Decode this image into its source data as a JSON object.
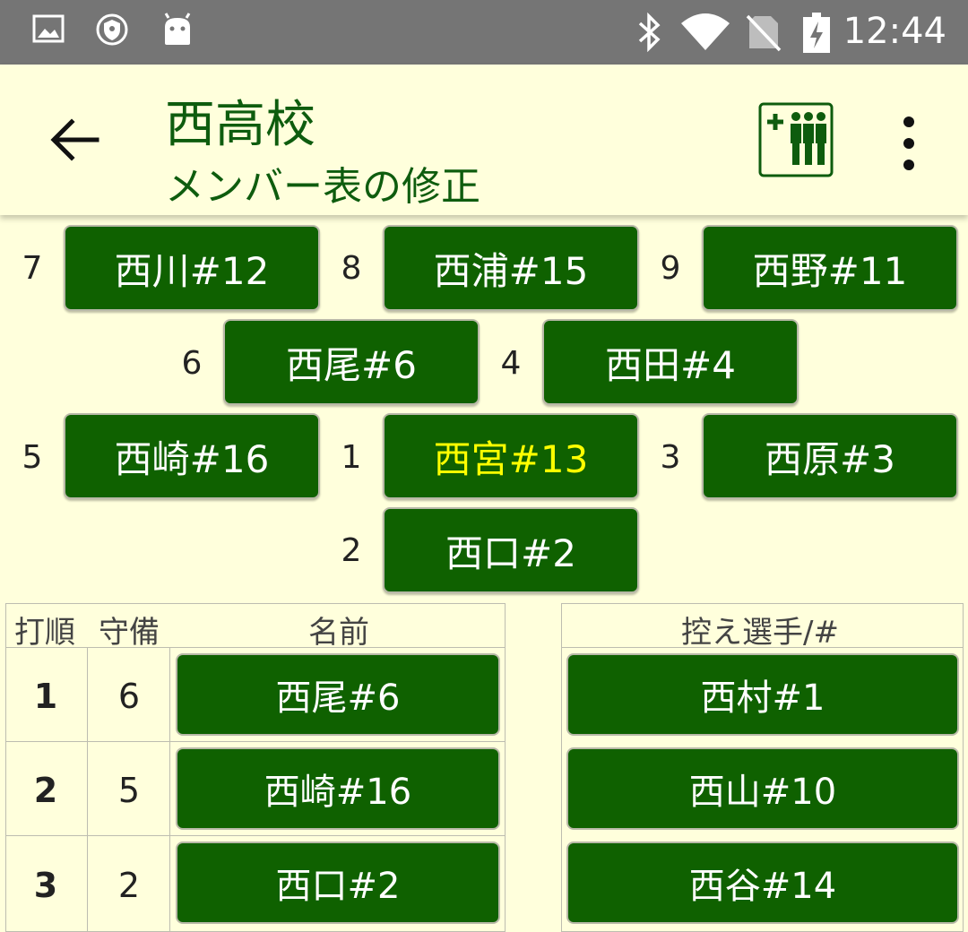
{
  "status_bar": {
    "time": "12:44",
    "icons": [
      "image-icon",
      "vpn-key-icon",
      "android-icon",
      "bluetooth-icon",
      "wifi-icon",
      "no-sim-icon",
      "battery-charging-icon"
    ]
  },
  "app_bar": {
    "title": "西高校",
    "subtitle": "メンバー表の修正",
    "icons": [
      "back-arrow-icon",
      "add-player-icon",
      "more-vert-icon"
    ]
  },
  "field": {
    "positions": [
      {
        "pos": "7",
        "name": "西川#12"
      },
      {
        "pos": "8",
        "name": "西浦#15"
      },
      {
        "pos": "9",
        "name": "西野#11"
      },
      {
        "pos": "6",
        "name": "西尾#6"
      },
      {
        "pos": "4",
        "name": "西田#4"
      },
      {
        "pos": "5",
        "name": "西崎#16"
      },
      {
        "pos": "1",
        "name": "西宮#13"
      },
      {
        "pos": "3",
        "name": "西原#3"
      },
      {
        "pos": "2",
        "name": "西口#2"
      }
    ],
    "highlight_color": "#ffff00"
  },
  "lineup": {
    "headers": {
      "order": "打順",
      "position": "守備",
      "name": "名前"
    },
    "rows": [
      {
        "order": "1",
        "position": "6",
        "name": "西尾#6"
      },
      {
        "order": "2",
        "position": "5",
        "name": "西崎#16"
      },
      {
        "order": "3",
        "position": "2",
        "name": "西口#2"
      }
    ]
  },
  "bench": {
    "header": "控え選手/#",
    "players": [
      "西村#1",
      "西山#10",
      "西谷#14"
    ]
  },
  "colors": {
    "button_green": "#0f6100",
    "background": "#ffffdc",
    "title_green": "#0e5c0e"
  }
}
